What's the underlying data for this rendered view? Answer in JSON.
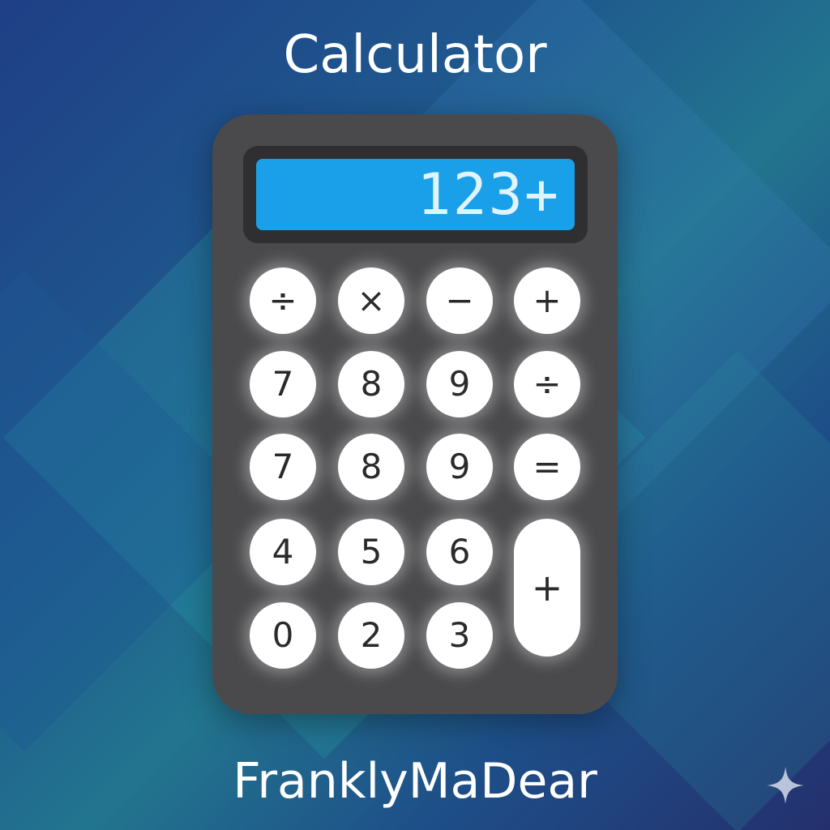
{
  "title": "Calculator",
  "display": {
    "value": "123+"
  },
  "keys": {
    "row1": [
      "÷",
      "×",
      "−",
      "+"
    ],
    "row2": [
      "7",
      "8",
      "9",
      "÷"
    ],
    "row3": [
      "7",
      "8",
      "9",
      "="
    ],
    "row4": [
      "4",
      "5",
      "6"
    ],
    "row5": [
      "0",
      "2",
      "3"
    ],
    "tall_key": "+"
  },
  "footer": "FranklyMaDear",
  "colors": {
    "display": "#1aa0e8",
    "body": "#4a4a4c",
    "key": "#ffffff"
  },
  "icons": {
    "corner": "sparkle-icon"
  }
}
